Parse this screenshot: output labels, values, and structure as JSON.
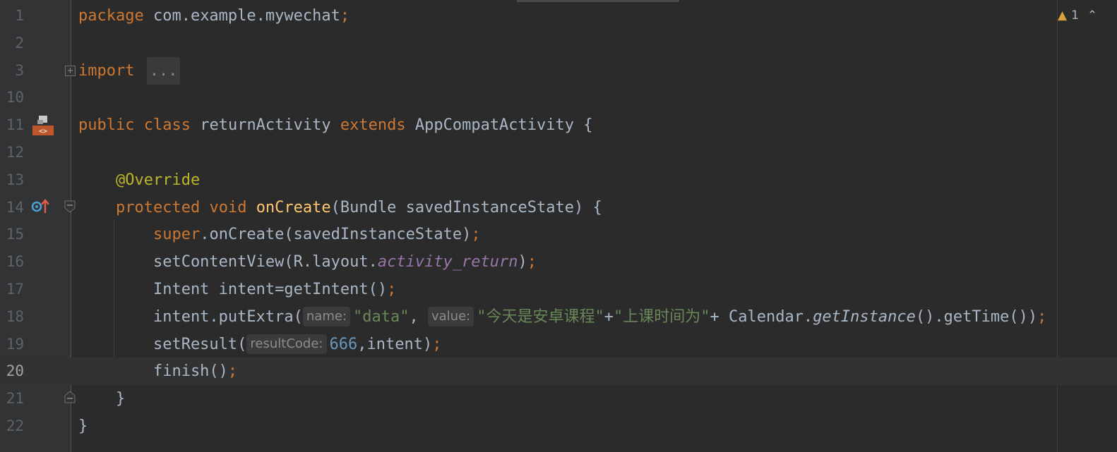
{
  "editor": {
    "inspection": {
      "warning_count": "1"
    },
    "lines": [
      {
        "num": "1",
        "parts": [
          [
            "package",
            "k"
          ],
          [
            " com.example.mywechat",
            ""
          ],
          [
            ";",
            "k"
          ]
        ]
      },
      {
        "num": "2",
        "parts": []
      },
      {
        "num": "3",
        "parts": [
          [
            "import",
            "k"
          ],
          [
            " ",
            ""
          ],
          [
            "...",
            "fold"
          ]
        ]
      },
      {
        "num": "10",
        "parts": []
      },
      {
        "num": "11",
        "parts": [
          [
            "public",
            "k"
          ],
          [
            " ",
            ""
          ],
          [
            "class",
            "k"
          ],
          [
            " returnActivity ",
            ""
          ],
          [
            "extends",
            "k"
          ],
          [
            " AppCompatActivity {",
            ""
          ]
        ]
      },
      {
        "num": "12",
        "parts": []
      },
      {
        "num": "13",
        "parts": [
          [
            "    ",
            ""
          ],
          [
            "@Override",
            "ann"
          ]
        ]
      },
      {
        "num": "14",
        "parts": [
          [
            "    ",
            ""
          ],
          [
            "protected",
            "k"
          ],
          [
            " ",
            ""
          ],
          [
            "void",
            "k"
          ],
          [
            " ",
            ""
          ],
          [
            "onCreate",
            "fn"
          ],
          [
            "(Bundle savedInstanceState) {",
            ""
          ]
        ]
      },
      {
        "num": "15",
        "parts": [
          [
            "        ",
            ""
          ],
          [
            "super",
            "k"
          ],
          [
            ".onCreate(savedInstanceState)",
            ""
          ],
          [
            ";",
            "k"
          ]
        ]
      },
      {
        "num": "16",
        "parts": [
          [
            "        setContentView(R.layout.",
            ""
          ],
          [
            "activity_return",
            "fld"
          ],
          [
            ")",
            ""
          ],
          [
            ";",
            "k"
          ]
        ]
      },
      {
        "num": "17",
        "parts": [
          [
            "        Intent intent=getIntent()",
            ""
          ],
          [
            ";",
            "k"
          ]
        ]
      },
      {
        "num": "18",
        "parts": [
          [
            "        intent.putExtra(",
            ""
          ],
          [
            "name:",
            "hint"
          ],
          [
            "\"data\"",
            "str"
          ],
          [
            ", ",
            ""
          ],
          [
            "value:",
            "hint"
          ],
          [
            "\"今天是安卓课程\"",
            "str"
          ],
          [
            "+",
            ""
          ],
          [
            "\"上课时间为\"",
            "str"
          ],
          [
            "+ Calendar.",
            ""
          ],
          [
            "getInstance",
            "it"
          ],
          [
            "().getTime())",
            ""
          ],
          [
            ";",
            "k"
          ]
        ]
      },
      {
        "num": "19",
        "parts": [
          [
            "        setResult(",
            ""
          ],
          [
            "resultCode:",
            "hint"
          ],
          [
            "666",
            "num"
          ],
          [
            ",intent)",
            ""
          ],
          [
            ";",
            "k"
          ]
        ]
      },
      {
        "num": "20",
        "parts": [
          [
            "        finish()",
            ""
          ],
          [
            ";",
            "k"
          ]
        ]
      },
      {
        "num": "21",
        "parts": [
          [
            "    }",
            ""
          ]
        ]
      },
      {
        "num": "22",
        "parts": [
          [
            "}",
            ""
          ]
        ]
      }
    ],
    "current_line_index": 13
  }
}
